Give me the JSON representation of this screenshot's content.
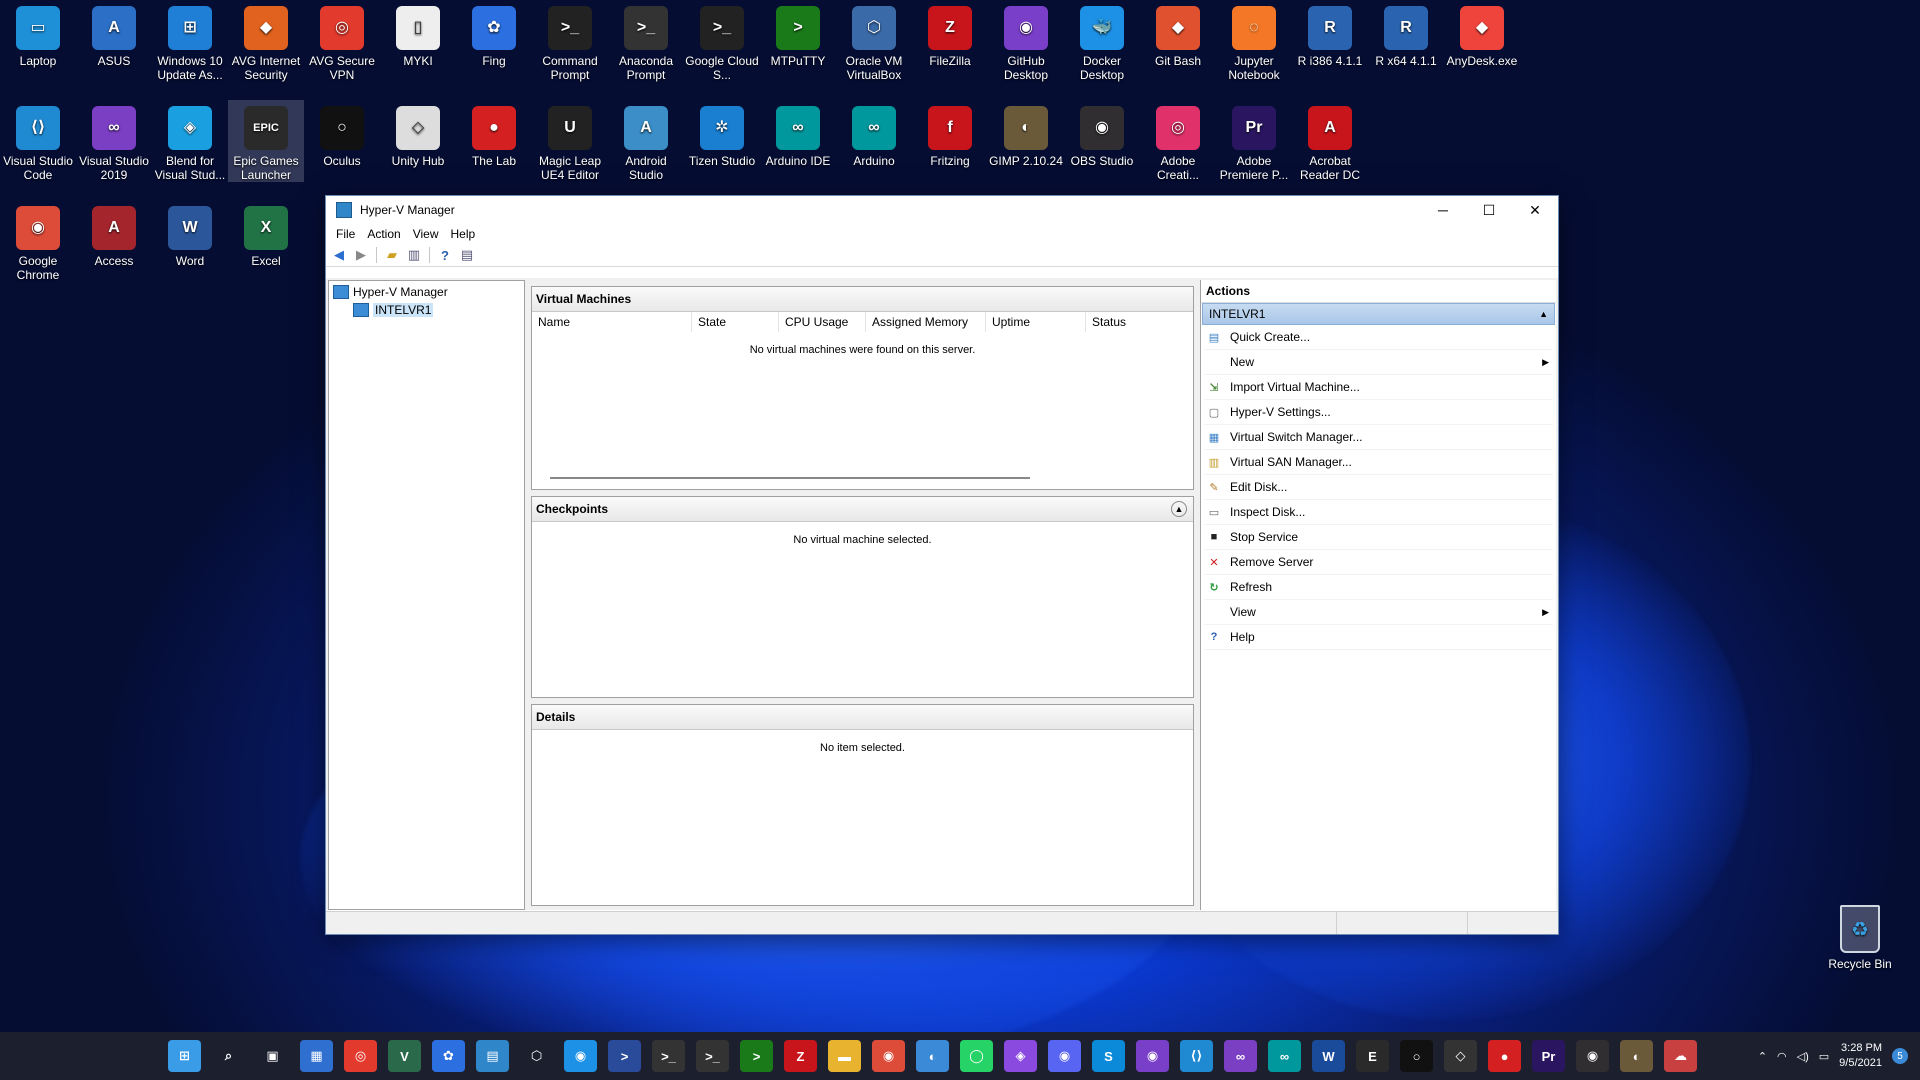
{
  "desktop": {
    "icons_row1": [
      {
        "label": "Laptop",
        "color": "#1e90d8",
        "glyph": "▭"
      },
      {
        "label": "ASUS",
        "color": "#2c6fc6",
        "glyph": "A"
      },
      {
        "label": "Windows 10 Update As...",
        "color": "#1f7fd6",
        "glyph": "⊞"
      },
      {
        "label": "AVG Internet Security",
        "color": "#e0621e",
        "glyph": "◆"
      },
      {
        "label": "AVG Secure VPN",
        "color": "#e23a2d",
        "glyph": "◎"
      },
      {
        "label": "MYKI",
        "color": "#eeeeee",
        "glyph": "▯"
      },
      {
        "label": "Fing",
        "color": "#2b6fe0",
        "glyph": "✿"
      },
      {
        "label": "Command Prompt",
        "color": "#222222",
        "glyph": ">_"
      },
      {
        "label": "Anaconda Prompt",
        "color": "#333333",
        "glyph": ">_"
      },
      {
        "label": "Google Cloud S...",
        "color": "#222222",
        "glyph": ">_"
      },
      {
        "label": "MTPuTTY",
        "color": "#1a7a1a",
        "glyph": ">"
      },
      {
        "label": "Oracle VM VirtualBox",
        "color": "#3a6aa8",
        "glyph": "⬡"
      },
      {
        "label": "FileZilla",
        "color": "#c8141b",
        "glyph": "Z"
      },
      {
        "label": "GitHub Desktop",
        "color": "#7a3fc8",
        "glyph": "◉"
      },
      {
        "label": "Docker Desktop",
        "color": "#1d91e6",
        "glyph": "🐳"
      },
      {
        "label": "Git Bash",
        "color": "#e0512f",
        "glyph": "◆"
      },
      {
        "label": "Jupyter Notebook",
        "color": "#f37726",
        "glyph": "◌"
      },
      {
        "label": "R i386 4.1.1",
        "color": "#2a64b0",
        "glyph": "R"
      },
      {
        "label": "R x64 4.1.1",
        "color": "#2a64b0",
        "glyph": "R"
      },
      {
        "label": "AnyDesk.exe",
        "color": "#ef443b",
        "glyph": "◆"
      }
    ],
    "icons_row2": [
      {
        "label": "Visual Studio Code",
        "color": "#1f8ad2",
        "glyph": "⟨⟩"
      },
      {
        "label": "Visual Studio 2019",
        "color": "#7b3fc4",
        "glyph": "∞"
      },
      {
        "label": "Blend for Visual Stud...",
        "color": "#1aa0e0",
        "glyph": "◈"
      },
      {
        "label": "Epic Games Launcher",
        "color": "#2a2a2a",
        "glyph": "EPIC"
      },
      {
        "label": "Oculus",
        "color": "#111111",
        "glyph": "○"
      },
      {
        "label": "Unity Hub",
        "color": "#dddddd",
        "glyph": "◇"
      },
      {
        "label": "The Lab",
        "color": "#d42020",
        "glyph": "●"
      },
      {
        "label": "Magic Leap UE4 Editor",
        "color": "#222222",
        "glyph": "U"
      },
      {
        "label": "Android Studio",
        "color": "#3b8ec7",
        "glyph": "A"
      },
      {
        "label": "Tizen Studio",
        "color": "#1a7fd0",
        "glyph": "✲"
      },
      {
        "label": "Arduino IDE",
        "color": "#00979d",
        "glyph": "∞"
      },
      {
        "label": "Arduino",
        "color": "#00979d",
        "glyph": "∞"
      },
      {
        "label": "Fritzing",
        "color": "#c8141b",
        "glyph": "f"
      },
      {
        "label": "GIMP 2.10.24",
        "color": "#6b5a3a",
        "glyph": "◐"
      },
      {
        "label": "OBS Studio",
        "color": "#302e31",
        "glyph": "◉"
      },
      {
        "label": "Adobe Creati...",
        "color": "#e0316a",
        "glyph": "◎"
      },
      {
        "label": "Adobe Premiere P...",
        "color": "#2a1660",
        "glyph": "Pr"
      },
      {
        "label": "Acrobat Reader DC",
        "color": "#c8141b",
        "glyph": "A"
      }
    ],
    "icons_row3": [
      {
        "label": "Google Chrome",
        "color": "#dd4b39",
        "glyph": "◉"
      },
      {
        "label": "Access",
        "color": "#a4262c",
        "glyph": "A"
      },
      {
        "label": "Word",
        "color": "#2b579a",
        "glyph": "W"
      },
      {
        "label": "Excel",
        "color": "#217346",
        "glyph": "X"
      }
    ],
    "recycle_bin": "Recycle Bin"
  },
  "window": {
    "title": "Hyper-V Manager",
    "menu": [
      "File",
      "Action",
      "View",
      "Help"
    ],
    "tree": {
      "root": "Hyper-V Manager",
      "child": "INTELVR1"
    },
    "vm_panel": {
      "title": "Virtual Machines",
      "columns": [
        "Name",
        "State",
        "CPU Usage",
        "Assigned Memory",
        "Uptime",
        "Status"
      ],
      "empty": "No virtual machines were found on this server."
    },
    "checkpoints_panel": {
      "title": "Checkpoints",
      "empty": "No virtual machine selected."
    },
    "details_panel": {
      "title": "Details",
      "empty": "No item selected."
    },
    "actions": {
      "title": "Actions",
      "section": "INTELVR1",
      "items": [
        {
          "label": "Quick Create...",
          "icon": "quick-create-icon",
          "glyph": "▤",
          "color": "#3a7fc4",
          "submenu": false
        },
        {
          "label": "New",
          "icon": "new-icon",
          "glyph": "",
          "color": "#000",
          "submenu": true
        },
        {
          "label": "Import Virtual Machine...",
          "icon": "import-icon",
          "glyph": "⇲",
          "color": "#4a8a3a",
          "submenu": false
        },
        {
          "label": "Hyper-V Settings...",
          "icon": "settings-icon",
          "glyph": "▢",
          "color": "#666",
          "submenu": false
        },
        {
          "label": "Virtual Switch Manager...",
          "icon": "switch-icon",
          "glyph": "▦",
          "color": "#3a7fc4",
          "submenu": false
        },
        {
          "label": "Virtual SAN Manager...",
          "icon": "san-icon",
          "glyph": "▥",
          "color": "#c49a2a",
          "submenu": false
        },
        {
          "label": "Edit Disk...",
          "icon": "edit-disk-icon",
          "glyph": "✎",
          "color": "#b07a2a",
          "submenu": false
        },
        {
          "label": "Inspect Disk...",
          "icon": "inspect-disk-icon",
          "glyph": "▭",
          "color": "#666",
          "submenu": false
        },
        {
          "label": "Stop Service",
          "icon": "stop-icon",
          "glyph": "■",
          "color": "#222",
          "submenu": false
        },
        {
          "label": "Remove Server",
          "icon": "remove-icon",
          "glyph": "✕",
          "color": "#d01c1c",
          "submenu": false
        },
        {
          "label": "Refresh",
          "icon": "refresh-icon",
          "glyph": "↻",
          "color": "#2a9a3a",
          "submenu": false
        },
        {
          "label": "View",
          "icon": "view-icon",
          "glyph": "",
          "color": "#000",
          "submenu": true
        },
        {
          "label": "Help",
          "icon": "help-icon",
          "glyph": "?",
          "color": "#2a5fb0",
          "submenu": false
        }
      ]
    }
  },
  "taskbar": {
    "apps": [
      {
        "name": "start-icon",
        "glyph": "⊞",
        "color": "#3a9be6"
      },
      {
        "name": "search-icon",
        "glyph": "⌕",
        "color": "transparent"
      },
      {
        "name": "task-view-icon",
        "glyph": "▣",
        "color": "transparent"
      },
      {
        "name": "widgets-icon",
        "glyph": "▦",
        "color": "#2f6fd0"
      },
      {
        "name": "avg-vpn-icon",
        "glyph": "◎",
        "color": "#e23a2d"
      },
      {
        "name": "veeam-icon",
        "glyph": "V",
        "color": "#2a6a4a"
      },
      {
        "name": "fing-icon",
        "glyph": "✿",
        "color": "#2b6fe0"
      },
      {
        "name": "hyperv-icon",
        "glyph": "▤",
        "color": "#2f86c9"
      },
      {
        "name": "virtualbox-icon",
        "glyph": "⬡",
        "color": "transparent"
      },
      {
        "name": "docker-icon",
        "glyph": "◉",
        "color": "#1d91e6"
      },
      {
        "name": "powershell-icon",
        "glyph": ">",
        "color": "#2a4a9a"
      },
      {
        "name": "cmd-icon",
        "glyph": ">_",
        "color": "#333"
      },
      {
        "name": "cmd2-icon",
        "glyph": ">_",
        "color": "#333"
      },
      {
        "name": "putty-icon",
        "glyph": ">",
        "color": "#1a7a1a"
      },
      {
        "name": "filezilla-icon",
        "glyph": "Z",
        "color": "#c8141b"
      },
      {
        "name": "explorer-icon",
        "glyph": "▬",
        "color": "#e8b430"
      },
      {
        "name": "chrome-icon",
        "glyph": "◉",
        "color": "#dd4b39"
      },
      {
        "name": "whatsapp-web-icon",
        "glyph": "◐",
        "color": "#3a8ad8"
      },
      {
        "name": "whatsapp-icon",
        "glyph": "◯",
        "color": "#25d366"
      },
      {
        "name": "messenger-icon",
        "glyph": "◈",
        "color": "#8a4ae0"
      },
      {
        "name": "discord-icon",
        "glyph": "◉",
        "color": "#5865f2"
      },
      {
        "name": "skype-icon",
        "glyph": "S",
        "color": "#0a8ad8"
      },
      {
        "name": "github-icon",
        "glyph": "◉",
        "color": "#7a3fc8"
      },
      {
        "name": "vscode-icon",
        "glyph": "⟨⟩",
        "color": "#1f8ad2"
      },
      {
        "name": "visual-studio-icon",
        "glyph": "∞",
        "color": "#7b3fc4"
      },
      {
        "name": "arduino-icon",
        "glyph": "∞",
        "color": "#00979d"
      },
      {
        "name": "word-pad-icon",
        "glyph": "W",
        "color": "#1a4a9a"
      },
      {
        "name": "epic-icon",
        "glyph": "E",
        "color": "#2a2a2a"
      },
      {
        "name": "oculus-icon",
        "glyph": "○",
        "color": "#111"
      },
      {
        "name": "unity-icon",
        "glyph": "◇",
        "color": "#333"
      },
      {
        "name": "thelab-icon",
        "glyph": "●",
        "color": "#d42020"
      },
      {
        "name": "premiere-icon",
        "glyph": "Pr",
        "color": "#2a1660"
      },
      {
        "name": "obs-icon",
        "glyph": "◉",
        "color": "#302e31"
      },
      {
        "name": "gimp-icon",
        "glyph": "◐",
        "color": "#6b5a3a"
      },
      {
        "name": "cloud-icon",
        "glyph": "☁",
        "color": "#c84040"
      }
    ],
    "time": "3:28 PM",
    "date": "9/5/2021",
    "notification_count": "5"
  }
}
